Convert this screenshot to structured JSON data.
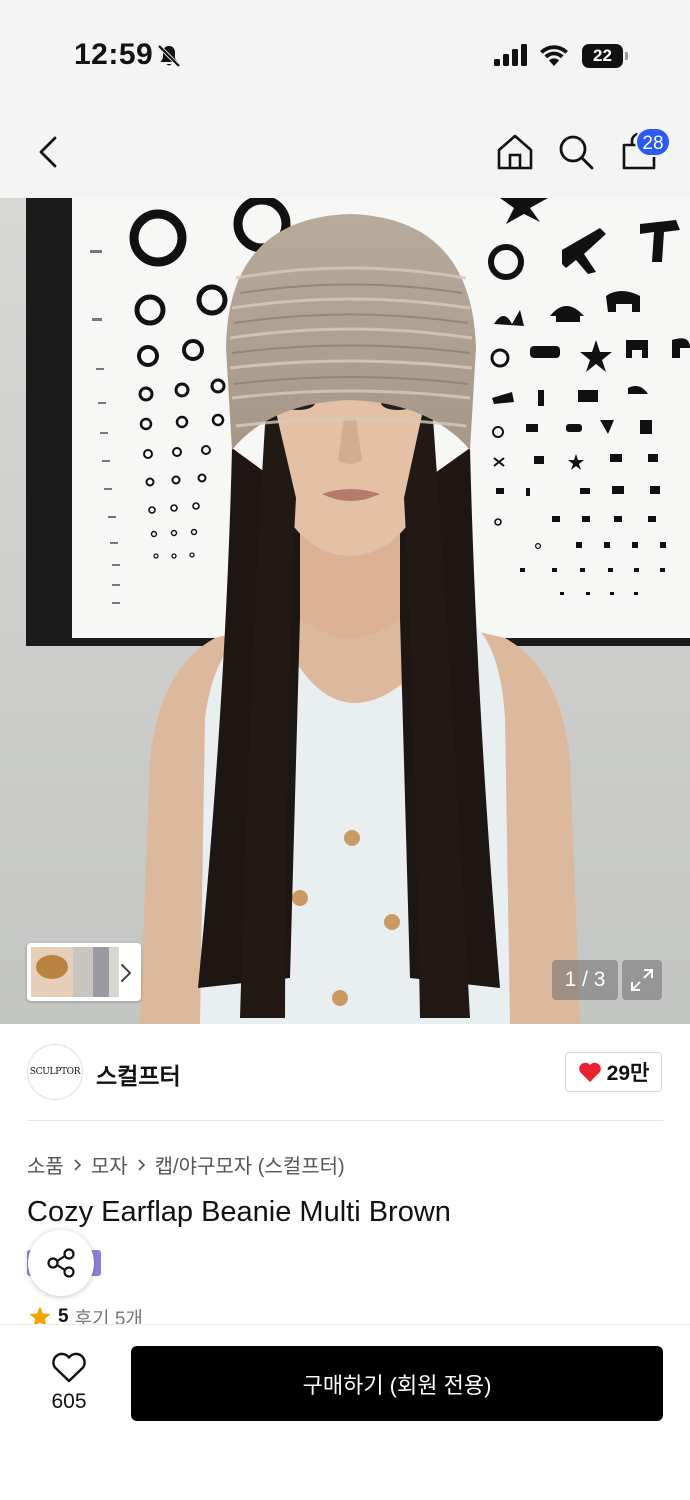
{
  "status_bar": {
    "time": "12:59",
    "battery": "22"
  },
  "nav": {
    "cart_count": "28"
  },
  "gallery": {
    "counter": "1 / 3"
  },
  "brand": {
    "logo_text": "SCULPTOR",
    "name": "스컬프터",
    "like_count": "29만"
  },
  "product": {
    "breadcrumb": [
      "소품",
      "모자",
      "캡/야구모자 (스컬프터)"
    ],
    "title": "Cozy Earflap Beanie Multi Brown",
    "rating": "5",
    "reviews": "후기 5개"
  },
  "actions": {
    "wish_count": "605",
    "buy_label": "구매하기 (회원 전용)"
  },
  "colors": {
    "accent": "#2b5bf1",
    "like": "#e8222e",
    "star": "#f5a300",
    "button": "#000000",
    "tag": "#8a82d8"
  },
  "icons": [
    "bell-slash-icon",
    "signal-icon",
    "wifi-icon",
    "back-icon",
    "home-icon",
    "search-icon",
    "shopping-bag-icon",
    "chevron-right-icon",
    "expand-icon",
    "heart-icon",
    "share-icon",
    "star-icon"
  ]
}
